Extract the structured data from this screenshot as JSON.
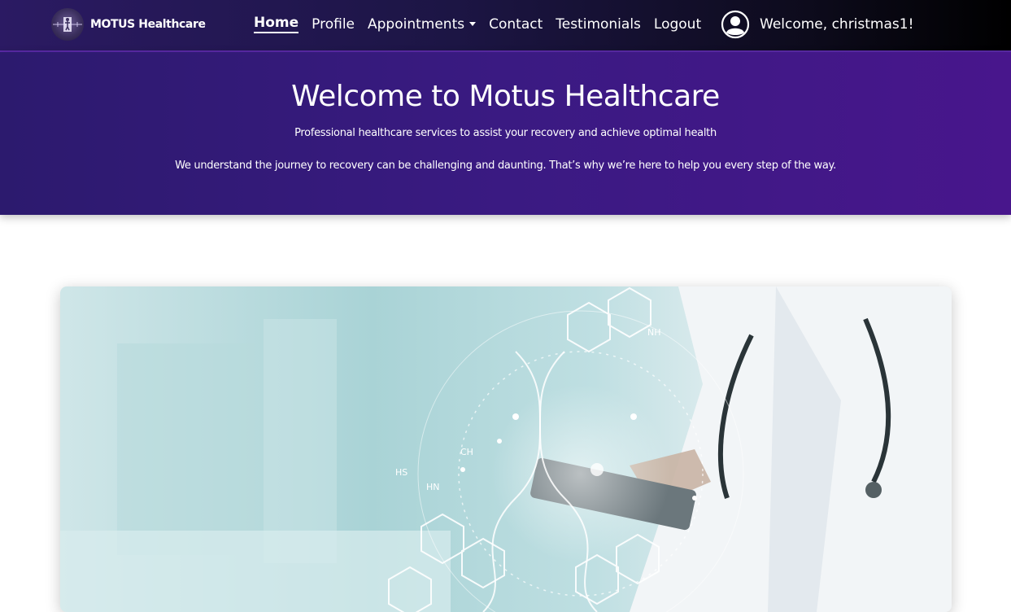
{
  "brand": {
    "name": "MOTUS Healthcare"
  },
  "nav": {
    "links": [
      {
        "label": "Home",
        "active": true
      },
      {
        "label": "Profile"
      },
      {
        "label": "Appointments",
        "dropdown": true
      },
      {
        "label": "Contact"
      },
      {
        "label": "Testimonials"
      },
      {
        "label": "Logout"
      }
    ]
  },
  "user": {
    "welcome": "Welcome, christmas1!",
    "icon": "user-circle-icon"
  },
  "hero": {
    "title": "Welcome to Motus Healthcare",
    "subtitle": "Professional healthcare services to assist your recovery and achieve optimal health",
    "text": "We understand the journey to recovery can be challenging and daunting. That’s why we’re here to help you every step of the way."
  },
  "image": {
    "labels": [
      "HS",
      "CH",
      "HN",
      "NH"
    ]
  },
  "colors": {
    "nav_start": "#2b1a63",
    "nav_end": "#000000",
    "hero_start": "#2c1a6e",
    "hero_end": "#48168c",
    "accent": "#5b2aa8"
  }
}
